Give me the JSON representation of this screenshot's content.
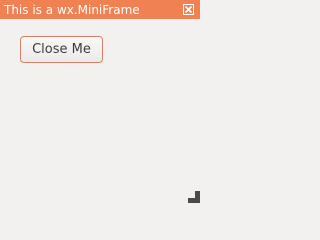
{
  "window": {
    "title": "This is a wx.MiniFrame",
    "close_icon": "close-box-icon"
  },
  "main": {
    "close_button_label": "Close Me"
  },
  "colors": {
    "titlebar": "#f08153",
    "title_text": "#ffffff",
    "background": "#f2f1f0",
    "button_border": "#d4806a",
    "grip": "#4a4a4a"
  }
}
